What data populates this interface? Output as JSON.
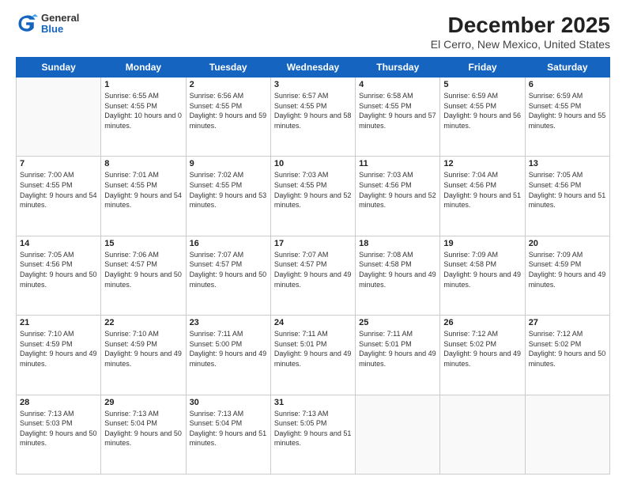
{
  "logo": {
    "general": "General",
    "blue": "Blue"
  },
  "title": "December 2025",
  "subtitle": "El Cerro, New Mexico, United States",
  "days_of_week": [
    "Sunday",
    "Monday",
    "Tuesday",
    "Wednesday",
    "Thursday",
    "Friday",
    "Saturday"
  ],
  "weeks": [
    [
      {
        "day": "",
        "sunrise": "",
        "sunset": "",
        "daylight": ""
      },
      {
        "day": "1",
        "sunrise": "Sunrise: 6:55 AM",
        "sunset": "Sunset: 4:55 PM",
        "daylight": "Daylight: 10 hours and 0 minutes."
      },
      {
        "day": "2",
        "sunrise": "Sunrise: 6:56 AM",
        "sunset": "Sunset: 4:55 PM",
        "daylight": "Daylight: 9 hours and 59 minutes."
      },
      {
        "day": "3",
        "sunrise": "Sunrise: 6:57 AM",
        "sunset": "Sunset: 4:55 PM",
        "daylight": "Daylight: 9 hours and 58 minutes."
      },
      {
        "day": "4",
        "sunrise": "Sunrise: 6:58 AM",
        "sunset": "Sunset: 4:55 PM",
        "daylight": "Daylight: 9 hours and 57 minutes."
      },
      {
        "day": "5",
        "sunrise": "Sunrise: 6:59 AM",
        "sunset": "Sunset: 4:55 PM",
        "daylight": "Daylight: 9 hours and 56 minutes."
      },
      {
        "day": "6",
        "sunrise": "Sunrise: 6:59 AM",
        "sunset": "Sunset: 4:55 PM",
        "daylight": "Daylight: 9 hours and 55 minutes."
      }
    ],
    [
      {
        "day": "7",
        "sunrise": "Sunrise: 7:00 AM",
        "sunset": "Sunset: 4:55 PM",
        "daylight": "Daylight: 9 hours and 54 minutes."
      },
      {
        "day": "8",
        "sunrise": "Sunrise: 7:01 AM",
        "sunset": "Sunset: 4:55 PM",
        "daylight": "Daylight: 9 hours and 54 minutes."
      },
      {
        "day": "9",
        "sunrise": "Sunrise: 7:02 AM",
        "sunset": "Sunset: 4:55 PM",
        "daylight": "Daylight: 9 hours and 53 minutes."
      },
      {
        "day": "10",
        "sunrise": "Sunrise: 7:03 AM",
        "sunset": "Sunset: 4:55 PM",
        "daylight": "Daylight: 9 hours and 52 minutes."
      },
      {
        "day": "11",
        "sunrise": "Sunrise: 7:03 AM",
        "sunset": "Sunset: 4:56 PM",
        "daylight": "Daylight: 9 hours and 52 minutes."
      },
      {
        "day": "12",
        "sunrise": "Sunrise: 7:04 AM",
        "sunset": "Sunset: 4:56 PM",
        "daylight": "Daylight: 9 hours and 51 minutes."
      },
      {
        "day": "13",
        "sunrise": "Sunrise: 7:05 AM",
        "sunset": "Sunset: 4:56 PM",
        "daylight": "Daylight: 9 hours and 51 minutes."
      }
    ],
    [
      {
        "day": "14",
        "sunrise": "Sunrise: 7:05 AM",
        "sunset": "Sunset: 4:56 PM",
        "daylight": "Daylight: 9 hours and 50 minutes."
      },
      {
        "day": "15",
        "sunrise": "Sunrise: 7:06 AM",
        "sunset": "Sunset: 4:57 PM",
        "daylight": "Daylight: 9 hours and 50 minutes."
      },
      {
        "day": "16",
        "sunrise": "Sunrise: 7:07 AM",
        "sunset": "Sunset: 4:57 PM",
        "daylight": "Daylight: 9 hours and 50 minutes."
      },
      {
        "day": "17",
        "sunrise": "Sunrise: 7:07 AM",
        "sunset": "Sunset: 4:57 PM",
        "daylight": "Daylight: 9 hours and 49 minutes."
      },
      {
        "day": "18",
        "sunrise": "Sunrise: 7:08 AM",
        "sunset": "Sunset: 4:58 PM",
        "daylight": "Daylight: 9 hours and 49 minutes."
      },
      {
        "day": "19",
        "sunrise": "Sunrise: 7:09 AM",
        "sunset": "Sunset: 4:58 PM",
        "daylight": "Daylight: 9 hours and 49 minutes."
      },
      {
        "day": "20",
        "sunrise": "Sunrise: 7:09 AM",
        "sunset": "Sunset: 4:59 PM",
        "daylight": "Daylight: 9 hours and 49 minutes."
      }
    ],
    [
      {
        "day": "21",
        "sunrise": "Sunrise: 7:10 AM",
        "sunset": "Sunset: 4:59 PM",
        "daylight": "Daylight: 9 hours and 49 minutes."
      },
      {
        "day": "22",
        "sunrise": "Sunrise: 7:10 AM",
        "sunset": "Sunset: 4:59 PM",
        "daylight": "Daylight: 9 hours and 49 minutes."
      },
      {
        "day": "23",
        "sunrise": "Sunrise: 7:11 AM",
        "sunset": "Sunset: 5:00 PM",
        "daylight": "Daylight: 9 hours and 49 minutes."
      },
      {
        "day": "24",
        "sunrise": "Sunrise: 7:11 AM",
        "sunset": "Sunset: 5:01 PM",
        "daylight": "Daylight: 9 hours and 49 minutes."
      },
      {
        "day": "25",
        "sunrise": "Sunrise: 7:11 AM",
        "sunset": "Sunset: 5:01 PM",
        "daylight": "Daylight: 9 hours and 49 minutes."
      },
      {
        "day": "26",
        "sunrise": "Sunrise: 7:12 AM",
        "sunset": "Sunset: 5:02 PM",
        "daylight": "Daylight: 9 hours and 49 minutes."
      },
      {
        "day": "27",
        "sunrise": "Sunrise: 7:12 AM",
        "sunset": "Sunset: 5:02 PM",
        "daylight": "Daylight: 9 hours and 50 minutes."
      }
    ],
    [
      {
        "day": "28",
        "sunrise": "Sunrise: 7:13 AM",
        "sunset": "Sunset: 5:03 PM",
        "daylight": "Daylight: 9 hours and 50 minutes."
      },
      {
        "day": "29",
        "sunrise": "Sunrise: 7:13 AM",
        "sunset": "Sunset: 5:04 PM",
        "daylight": "Daylight: 9 hours and 50 minutes."
      },
      {
        "day": "30",
        "sunrise": "Sunrise: 7:13 AM",
        "sunset": "Sunset: 5:04 PM",
        "daylight": "Daylight: 9 hours and 51 minutes."
      },
      {
        "day": "31",
        "sunrise": "Sunrise: 7:13 AM",
        "sunset": "Sunset: 5:05 PM",
        "daylight": "Daylight: 9 hours and 51 minutes."
      },
      {
        "day": "",
        "sunrise": "",
        "sunset": "",
        "daylight": ""
      },
      {
        "day": "",
        "sunrise": "",
        "sunset": "",
        "daylight": ""
      },
      {
        "day": "",
        "sunrise": "",
        "sunset": "",
        "daylight": ""
      }
    ]
  ]
}
